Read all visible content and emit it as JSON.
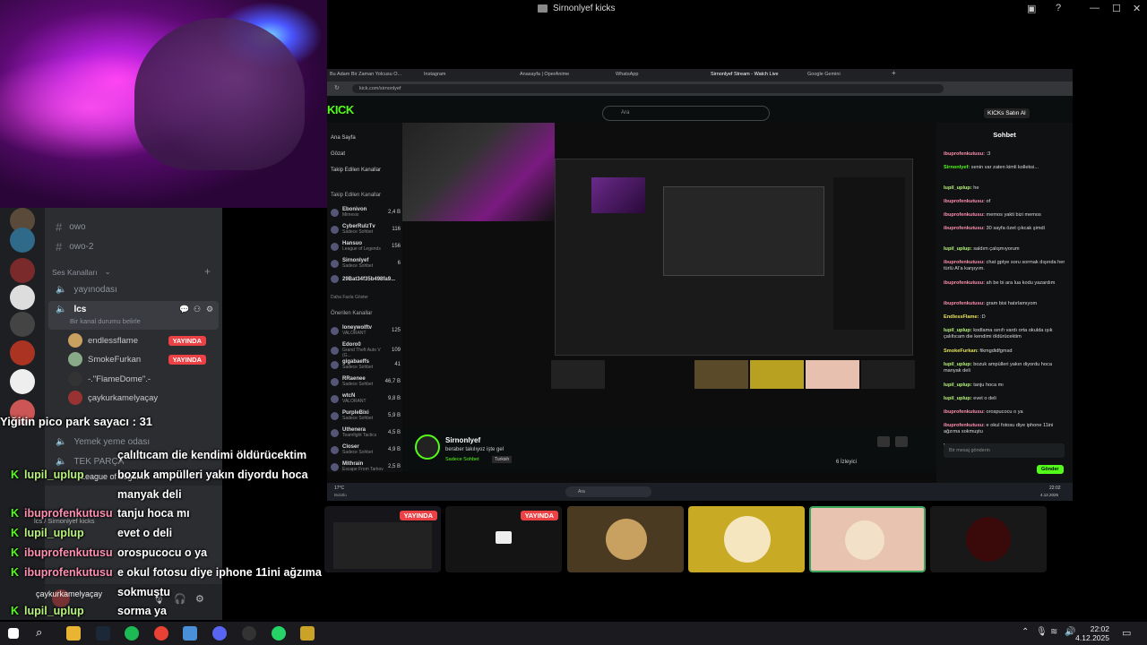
{
  "window": {
    "title": "Sirnonlyef kicks"
  },
  "browser": {
    "tabs": [
      "Bu Adam Bir Zaman Yolcusu O...",
      "Instagram",
      "Anasayfa | OperAnime",
      "WhatsApp",
      "Sirnonlyef Stream - Watch Live",
      "Google Gemini"
    ],
    "url": "kick.com/sirnonlyef"
  },
  "kick": {
    "search_placeholder": "Ara",
    "buy_label": "KICKs Satın Al",
    "nav": [
      "Ana Sayfa",
      "Gözat",
      "Takip Edilen Kanallar",
      "Önerilen Kanallar"
    ],
    "followed_header": "Takip Edilen Kanallar",
    "followed": [
      {
        "name": "Ebonivon",
        "sub": "Mimesis",
        "viewers": "2,4 B"
      },
      {
        "name": "CyberRulzTv",
        "sub": "Sadece Sohbet",
        "viewers": "116"
      },
      {
        "name": "Hansuo",
        "sub": "League of Legends",
        "viewers": "156"
      },
      {
        "name": "Sirnonlyef",
        "sub": "Sadece Sohbet",
        "viewers": "6"
      },
      {
        "name": "29Bat34f35b498fa9...",
        "sub": "",
        "viewers": ""
      }
    ],
    "more_label": "Daha Fazla Göster",
    "recommended_header": "Önerilen Kanallar",
    "recommended": [
      {
        "name": "loneywolftv",
        "sub": "VALORANT",
        "viewers": "125"
      },
      {
        "name": "Edoro0",
        "sub": "Grand Theft Auto V (G...",
        "viewers": "109"
      },
      {
        "name": "gigabaeffs",
        "sub": "Sadece Sohbet",
        "viewers": "41"
      },
      {
        "name": "RRaenee",
        "sub": "Sadece Sohbet",
        "viewers": "46,7 B"
      },
      {
        "name": "wtcN",
        "sub": "VALORANT",
        "viewers": "9,8 B"
      },
      {
        "name": "PurpleBixi",
        "sub": "Sadece Sohbet",
        "viewers": "5,9 B"
      },
      {
        "name": "Uthenera",
        "sub": "Teamfight Tactics",
        "viewers": "4,5 B"
      },
      {
        "name": "Closer",
        "sub": "Sadece Sohbet",
        "viewers": "4,9 B"
      },
      {
        "name": "Mithrain",
        "sub": "Escape From Tarkov",
        "viewers": "2,5 B"
      }
    ],
    "streamer": {
      "name": "Sirnonlyef",
      "title": "beraber takılıyoz işte gel",
      "category": "Sadece Sohbet",
      "language": "Turkish",
      "viewers": "6 İzleyici"
    },
    "chat": {
      "header": "Sohbet",
      "messages": [
        {
          "user": "ibuprofenkutusu:",
          "text": " :3"
        },
        {
          "user": "Sirnonlyef:",
          "text": " senin var zaten kimli kolleksi..."
        },
        {
          "user": "lupil_uplup:",
          "text": " he"
        },
        {
          "user": "ibuprofenkutusu:",
          "text": " of"
        },
        {
          "user": "ibuprofenkutusu:",
          "text": " memos yakti bizi memos"
        },
        {
          "user": "ibuprofenkutusu:",
          "text": " 30 sayfa özet çıkcak şimdi"
        },
        {
          "user": "lupil_uplup:",
          "text": " saldım çalışmıyorum"
        },
        {
          "user": "ibuprofenkutusu:",
          "text": " chat gptye soru sormak dışında her türlü AI'a karşıyım."
        },
        {
          "user": "ibuprofenkutusu:",
          "text": " ah be bi ara lua kodu yazardım"
        },
        {
          "user": "ibuprofenkutusu:",
          "text": " gram bisi hatırlamıyom"
        },
        {
          "user": "EndlessFlame:",
          "text": " :D"
        },
        {
          "user": "lupil_uplup:",
          "text": " kodlama sınıfı vardı orta okulda ışık çalıltıcam die kendimi öldürücektim"
        },
        {
          "user": "SmokeFurkan:",
          "text": " fikmgdidfgmsd"
        },
        {
          "user": "lupil_uplup:",
          "text": " bozuk ampülleri yakın diyordu hoca manyak deli"
        },
        {
          "user": "lupil_uplup:",
          "text": " tanju hoca mı"
        },
        {
          "user": "lupil_uplup:",
          "text": " evet o deli"
        },
        {
          "user": "ibuprofenkutusu:",
          "text": " orospucocu o ya"
        },
        {
          "user": "ibuprofenkutusu:",
          "text": " e okul fotosu diye iphone 11ini ağzıma sokmuştu"
        },
        {
          "user": "lupil_uplup:",
          "text": " sorma ya"
        }
      ],
      "input_placeholder": "Bir mesaj gönderin",
      "send_label": "Gönder"
    },
    "inner_taskbar": {
      "weather": "17°C",
      "weather_sub": "Bulutlu",
      "search": "Ara",
      "time": "22:02",
      "date": "4.12.2025"
    }
  },
  "discord": {
    "channels_top": [
      "owo",
      "owo-2"
    ],
    "voice_header": "Ses Kanalları",
    "voice_channels": [
      "yayınodası",
      "lcs"
    ],
    "lcs_status": "Bir kanal durumu belirle",
    "voice_users": [
      {
        "name": "endlessflame",
        "live": "YAYINDA"
      },
      {
        "name": "SmokeFurkan",
        "live": "YAYINDA"
      },
      {
        "name": "-.\"FlameDome\".-",
        "live": ""
      },
      {
        "name": "çaykurkamelyaçay",
        "live": ""
      }
    ],
    "bottom_channels": [
      "Yemek yeme odası",
      "TEK PARÇA"
    ],
    "user_panel": {
      "name": "çaykurkamelyaçay",
      "sub": "lcs / Sirnonlyef kicks"
    },
    "game_status": "League of Legends"
  },
  "overlay": {
    "counter": "Yiğitin pico park sayacı : 31",
    "lines": [
      {
        "user": "",
        "text": "çalıltıcam die kendimi öldürücektim"
      },
      {
        "user": "lupil_uplup",
        "text": "bozuk ampülleri yakın diyordu hoca"
      },
      {
        "user": "",
        "text": "manyak deli"
      },
      {
        "user": "ibuprofenkutusu",
        "text": "tanju hoca mı"
      },
      {
        "user": "lupil_uplup",
        "text": "evet o deli"
      },
      {
        "user": "ibuprofenkutusu",
        "text": "orospucocu o ya"
      },
      {
        "user": "ibuprofenkutusu",
        "text": "e okul fotosu diye iphone 11ini ağzıma"
      },
      {
        "user": "",
        "text": "sokmuştu"
      },
      {
        "user": "lupil_uplup",
        "text": "sorma ya"
      }
    ]
  },
  "tiles": [
    {
      "live": "YAYINDA"
    },
    {
      "live": "YAYINDA"
    },
    {
      "live": ""
    },
    {
      "live": ""
    },
    {
      "live": ""
    },
    {
      "live": ""
    }
  ],
  "taskbar": {
    "time": "22:02",
    "date": "4.12.2025"
  },
  "colors": {
    "kick_green": "#53fc18",
    "live_red": "#ed4245",
    "discord_bg": "#2b2d31",
    "user_green": "#b8f37a",
    "user_pink": "#ff8fb0"
  }
}
